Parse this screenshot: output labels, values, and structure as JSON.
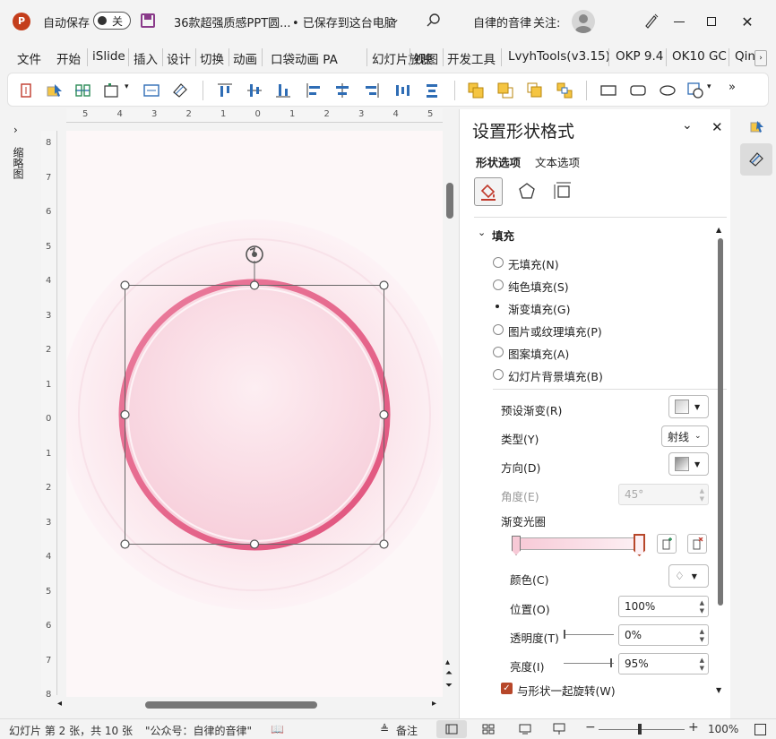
{
  "titlebar": {
    "autosave_label": "自动保存",
    "autosave_state": "关",
    "doc_title": "36款超强质感PPT圆...",
    "save_status": "• 已保存到这台电脑",
    "user_name": "自律的音律",
    "follow_label": "关注:"
  },
  "menu": [
    "文件",
    "开始",
    "iSlide",
    "插入",
    "设计",
    "切换",
    "动画",
    "口袋动画 PA",
    "幻灯片放映",
    "视图",
    "开发工具",
    "LvyhTools(v3.15)",
    "OKP 9.4",
    "OK10 GC",
    "Qin"
  ],
  "left_panel_label": "缩略图",
  "hruler_ticks": [
    "5",
    "4",
    "3",
    "2",
    "1",
    "0",
    "1",
    "2",
    "3",
    "4",
    "5"
  ],
  "vruler_ticks": [
    "8",
    "7",
    "6",
    "5",
    "4",
    "3",
    "2",
    "1",
    "0",
    "1",
    "2",
    "3",
    "4",
    "5",
    "6",
    "7",
    "8"
  ],
  "pane": {
    "title": "设置形状格式",
    "tab_shape": "形状选项",
    "tab_text": "文本选项",
    "section_fill": "填充",
    "fill_options": [
      {
        "label": "无填充(N)",
        "selected": false
      },
      {
        "label": "纯色填充(S)",
        "selected": false
      },
      {
        "label": "渐变填充(G)",
        "selected": true
      },
      {
        "label": "图片或纹理填充(P)",
        "selected": false
      },
      {
        "label": "图案填充(A)",
        "selected": false
      },
      {
        "label": "幻灯片背景填充(B)",
        "selected": false
      }
    ],
    "preset_label": "预设渐变(R)",
    "type_label": "类型(Y)",
    "type_value": "射线",
    "direction_label": "方向(D)",
    "angle_label": "角度(E)",
    "angle_value": "45°",
    "stops_label": "渐变光圈",
    "color_label": "颜色(C)",
    "position_label": "位置(O)",
    "position_value": "100%",
    "transparency_label": "透明度(T)",
    "transparency_value": "0%",
    "brightness_label": "亮度(I)",
    "brightness_value": "95%",
    "rotate_label": "与形状一起旋转(W)",
    "rotate_checked": true
  },
  "status": {
    "slide_info": "幻灯片 第 2 张，共 10 张",
    "author": "\"公众号：自律的音律\"",
    "notes_label": "备注",
    "zoom": "100%"
  },
  "colors": {
    "accent": "#b7472a",
    "ring": "#e57a9a",
    "slide_bg": "#fdf7f8",
    "circle_fill": "#fbe3ea"
  }
}
